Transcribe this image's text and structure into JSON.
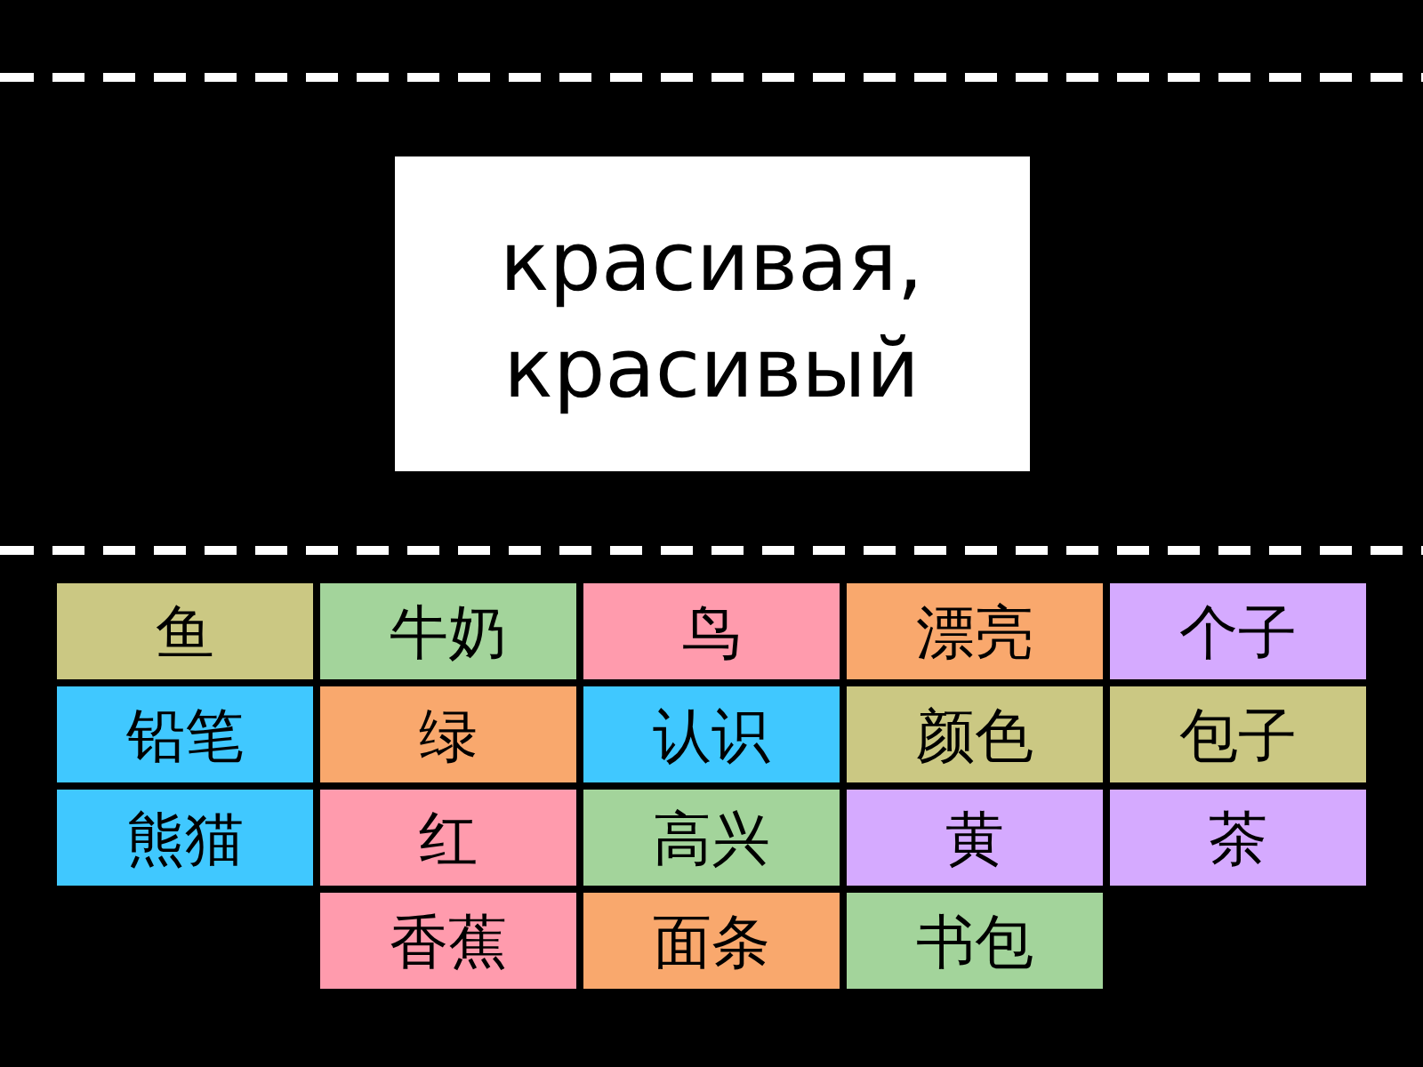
{
  "prompt": {
    "text": "красивая, красивый"
  },
  "tiles": [
    {
      "text": "鱼",
      "color": "#cbc883"
    },
    {
      "text": "牛奶",
      "color": "#a3d49b"
    },
    {
      "text": "鸟",
      "color": "#ff9bad"
    },
    {
      "text": "漂亮",
      "color": "#f9a86d"
    },
    {
      "text": "个子",
      "color": "#d5aaff"
    },
    {
      "text": "铅笔",
      "color": "#40c8ff"
    },
    {
      "text": "绿",
      "color": "#f9a86d"
    },
    {
      "text": "认识",
      "color": "#40c8ff"
    },
    {
      "text": "颜色",
      "color": "#cbc883"
    },
    {
      "text": "包子",
      "color": "#cbc883"
    },
    {
      "text": "熊猫",
      "color": "#40c8ff"
    },
    {
      "text": "红",
      "color": "#ff9bad"
    },
    {
      "text": "高兴",
      "color": "#a3d49b"
    },
    {
      "text": "黄",
      "color": "#d5aaff"
    },
    {
      "text": "茶",
      "color": "#d5aaff"
    },
    {
      "text": "香蕉",
      "color": "#ff9bad"
    },
    {
      "text": "面条",
      "color": "#f9a86d"
    },
    {
      "text": "书包",
      "color": "#a3d49b"
    }
  ]
}
